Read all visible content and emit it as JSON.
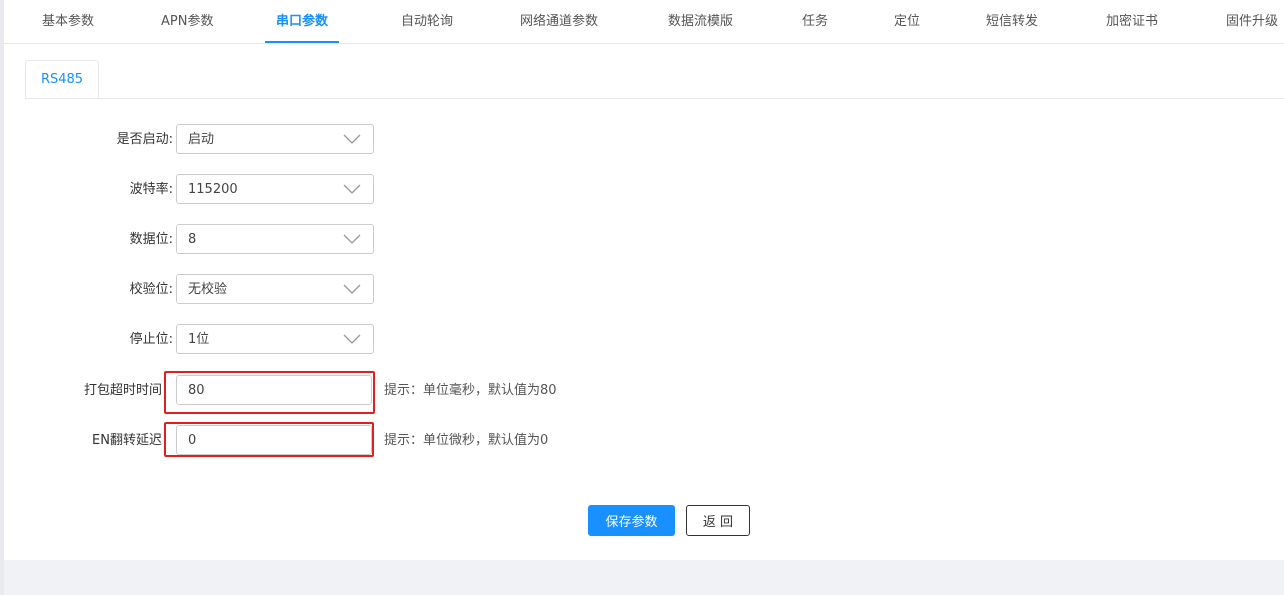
{
  "top_tabs": [
    {
      "label": "基本参数"
    },
    {
      "label": "APN参数"
    },
    {
      "label": "串口参数",
      "active": true
    },
    {
      "label": "自动轮询"
    },
    {
      "label": "网络通道参数"
    },
    {
      "label": "数据流模版"
    },
    {
      "label": "任务"
    },
    {
      "label": "定位"
    },
    {
      "label": "短信转发"
    },
    {
      "label": "加密证书"
    },
    {
      "label": "固件升级"
    }
  ],
  "sub_tabs": [
    {
      "label": "RS485"
    }
  ],
  "form": {
    "enable": {
      "label": "是否启动:",
      "value": "启动"
    },
    "baud": {
      "label": "波特率:",
      "value": "115200"
    },
    "databits": {
      "label": "数据位:",
      "value": "8"
    },
    "parity": {
      "label": "校验位:",
      "value": "无校验"
    },
    "stopbits": {
      "label": "停止位:",
      "value": "1位"
    },
    "pack_timeout": {
      "label": "打包超时时间",
      "value": "80",
      "hint": "提示：单位毫秒，默认值为80"
    },
    "en_delay": {
      "label": "EN翻转延迟",
      "value": "0",
      "hint": "提示：单位微秒，默认值为0"
    }
  },
  "buttons": {
    "save": "保存参数",
    "back": "返 回"
  },
  "colors": {
    "accent": "#1890ff",
    "highlight": "#e02020",
    "footer": "#f0f2f5"
  }
}
